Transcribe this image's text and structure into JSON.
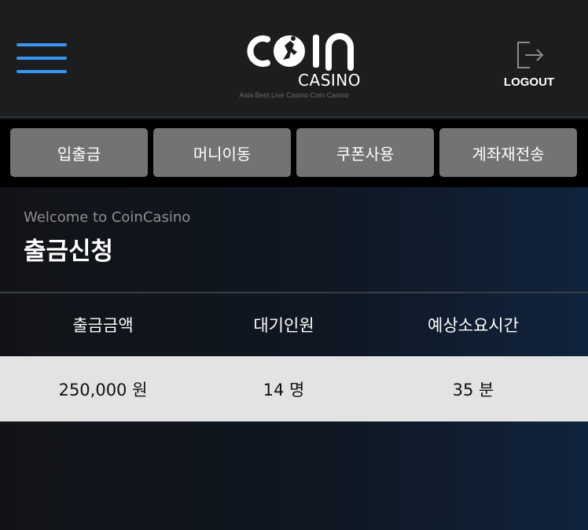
{
  "header": {
    "logo": {
      "wordmark": "COIN",
      "subtitle": "CASINO",
      "tagline": "Asia Best Live Casino Coin Casino"
    },
    "logout_label": "LOGOUT",
    "icons": {
      "menu": "hamburger-menu-icon",
      "logout": "logout-icon"
    },
    "accent_color": "#3596f3"
  },
  "tabs": [
    {
      "label": "입출금"
    },
    {
      "label": "머니이동"
    },
    {
      "label": "쿠폰사용"
    },
    {
      "label": "계좌재전송"
    }
  ],
  "page": {
    "welcome": "Welcome to CoinCasino",
    "title": "출금신청"
  },
  "table": {
    "headers": [
      "출금금액",
      "대기인원",
      "예상소요시간"
    ],
    "row": [
      "250,000 원",
      "14 명",
      "35 분"
    ]
  }
}
